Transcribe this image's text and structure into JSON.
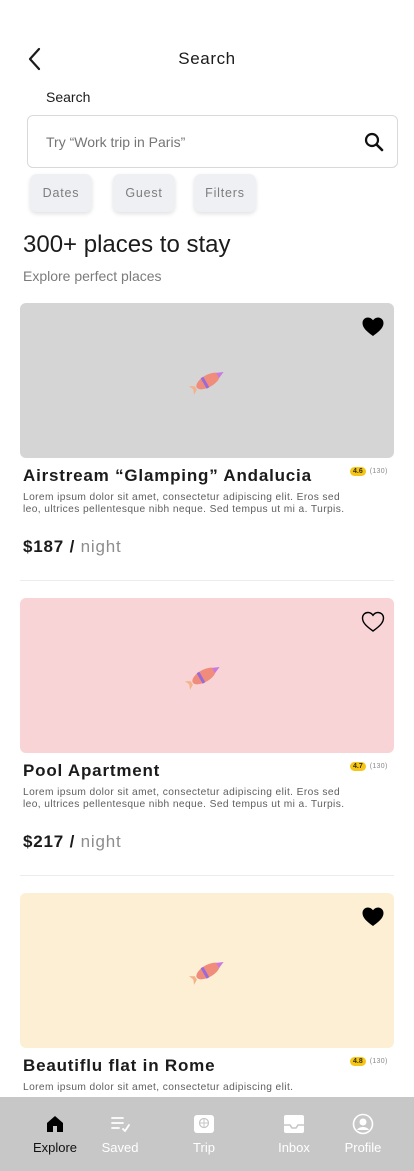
{
  "header": {
    "title": "Search",
    "back_icon": "chevron-left-icon"
  },
  "search": {
    "label": "Search",
    "placeholder": "Try “Work trip in Paris”",
    "icon": "search-icon"
  },
  "filters": [
    {
      "label": "Dates"
    },
    {
      "label": "Guest"
    },
    {
      "label": "Filters"
    }
  ],
  "results": {
    "heading": "300+ places to stay",
    "subheading": "Explore perfect places"
  },
  "listings": [
    {
      "title": "Airstream “Glamping” Andalucia",
      "rating": "4.6",
      "reviews": "(130)",
      "description": "Lorem ipsum dolor sit amet, consectetur adipiscing elit. Eros sed leo, ultrices pellentesque nibh neque. Sed tempus ut mi a. Turpis.",
      "price": "$187",
      "price_sep": "/",
      "price_unit": "night",
      "favorited": true,
      "image_color": "#d5d5d5"
    },
    {
      "title": "Pool Apartment",
      "rating": "4.7",
      "reviews": "(130)",
      "description": "Lorem ipsum dolor sit amet, consectetur adipiscing elit. Eros sed leo, ultrices pellentesque nibh neque. Sed tempus ut mi a. Turpis.",
      "price": "$217",
      "price_sep": "/",
      "price_unit": "night",
      "favorited": false,
      "image_color": "#f8d4d6"
    },
    {
      "title": "Beautiflu flat in Rome",
      "rating": "4.8",
      "reviews": "(130)",
      "description": "Lorem ipsum dolor sit amet, consectetur adipiscing elit.",
      "favorited": true,
      "image_color": "#fcefd4"
    }
  ],
  "nav": {
    "items": [
      {
        "label": "Explore",
        "icon": "home-icon",
        "active": true
      },
      {
        "label": "Saved",
        "icon": "saved-list-icon",
        "active": false
      },
      {
        "label": "Trip",
        "icon": "trip-icon",
        "active": false
      },
      {
        "label": "Inbox",
        "icon": "inbox-icon",
        "active": false
      },
      {
        "label": "Profile",
        "icon": "profile-icon",
        "active": false
      }
    ]
  },
  "colors": {
    "rating_badge": "#f5c518",
    "nav_background": "#c7c7c7",
    "chip_background": "#eef0f3"
  }
}
